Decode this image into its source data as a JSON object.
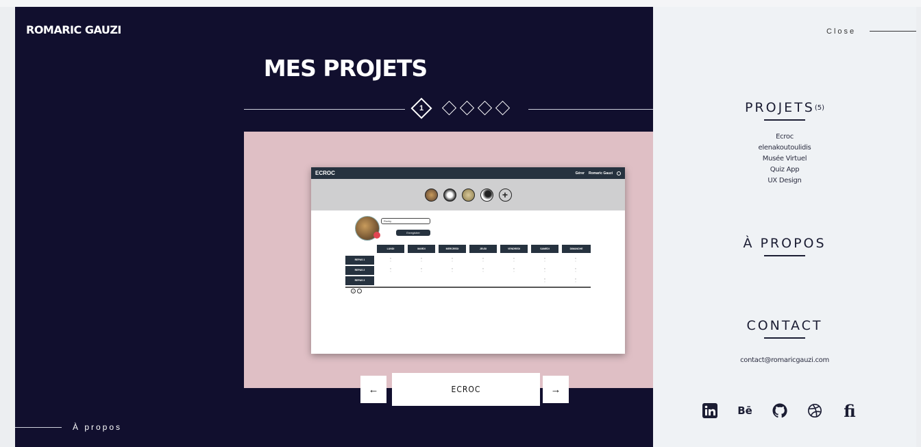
{
  "header": {
    "brand": "ROMARIC GAUZI"
  },
  "main": {
    "title": "MES PROJETS",
    "pager": {
      "active_number": "1"
    },
    "current_project": "ECROC",
    "about_link": "À propos"
  },
  "mock": {
    "app_title": "ECROC",
    "top_right_1": "Gérer",
    "top_right_2": "Romaric Gauzi",
    "input_value": "Rocky",
    "save_label": "Enregistrer",
    "days": [
      "LUNDI",
      "MARDI",
      "MERCREDI",
      "JEUDI",
      "VENDREDI",
      "SAMEDI",
      "DIMANCHE"
    ],
    "rows": [
      "REPAS 1",
      "REPAS 2",
      "REPAS 3"
    ]
  },
  "sidebar": {
    "close_label": "Close",
    "projects_title": "PROJETS",
    "projects_count": "(5)",
    "projects": [
      "Ecroc",
      "elenakoutoulidis",
      "Musée Virtuel",
      "Quiz App",
      "UX Design"
    ],
    "about_title": "À PROPOS",
    "contact_title": "CONTACT",
    "email": "contact@romaricgauzi.com",
    "social_icons": [
      "linkedin-icon",
      "behance-icon",
      "github-icon",
      "dribbble-icon",
      "fi-icon"
    ]
  }
}
